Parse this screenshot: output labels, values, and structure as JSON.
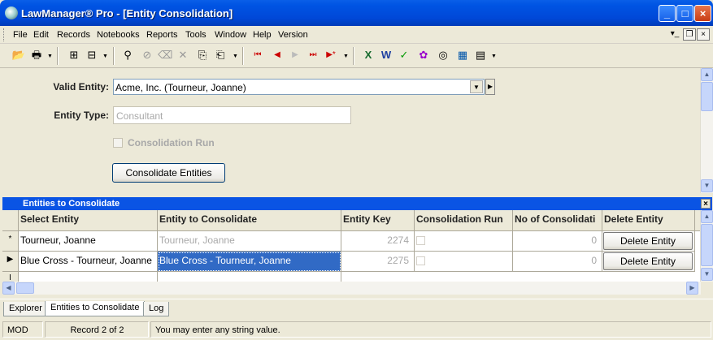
{
  "window": {
    "title": "LawManager® Pro - [Entity Consolidation]"
  },
  "menu": [
    "File",
    "Edit",
    "Records",
    "Notebooks",
    "Reports",
    "Tools",
    "Window",
    "Help",
    "Version"
  ],
  "form": {
    "valid_entity_label": "Valid Entity:",
    "valid_entity_value": "Acme, Inc. (Tourneur, Joanne)",
    "entity_type_label": "Entity Type:",
    "entity_type_value": "Consultant",
    "consolidation_run_label": "Consolidation Run",
    "consolidate_button": "Consolidate Entities"
  },
  "subform": {
    "title": "Entities to Consolidate",
    "columns": [
      "Select Entity",
      "Entity to Consolidate",
      "Entity Key",
      "Consolidation Run",
      "No of Consolidati",
      "Delete Entity"
    ],
    "rows": [
      {
        "marker": "*",
        "select_entity": "Tourneur, Joanne",
        "entity_to_consolidate": "Tourneur, Joanne",
        "entity_key": "2274",
        "no_of_consolidations": "0",
        "delete_label": "Delete Entity"
      },
      {
        "marker": "▶",
        "select_entity": "Blue Cross - Tourneur, Joanne",
        "entity_to_consolidate": "Blue Cross - Tourneur, Joanne",
        "entity_key": "2275",
        "no_of_consolidations": "0",
        "delete_label": "Delete Entity"
      }
    ],
    "new_row_marker": "I"
  },
  "tabs": [
    "Explorer",
    "Entities to Consolidate",
    "Log"
  ],
  "status": {
    "mode": "MOD",
    "record": "Record 2 of 2",
    "message": "You may enter any string value."
  }
}
